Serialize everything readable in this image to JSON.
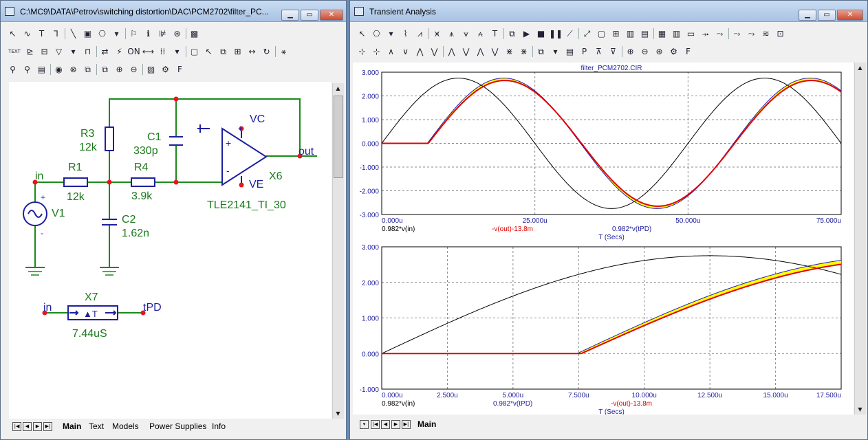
{
  "schematic": {
    "title": "C:\\MC9\\DATA\\Petrov\\switching distortion\\DAC\\PCM2702\\filter_PC...",
    "window_buttons": [
      "▁",
      "▭",
      "✕"
    ],
    "toolbar_row1": [
      "↖",
      "∿",
      "T",
      "⅂",
      "╲",
      "▣",
      "⎔",
      "▾",
      "⚐",
      "ℹ",
      "⊯",
      "⊛",
      "▩"
    ],
    "toolbar_row2": [
      "TEXT",
      "⊵",
      "⊟",
      "▽",
      "▾",
      "⊓",
      "⇄",
      "⚡",
      "ON",
      "⟷",
      "⁞⁞",
      "▾",
      "▢",
      "↖",
      "⧉",
      "⊞",
      "↔",
      "↻",
      "⚹"
    ],
    "toolbar_row3": [
      "⚲",
      "⚲",
      "▤",
      "◉",
      "⊗",
      "⧉",
      "⧉",
      "⊕",
      "⊖",
      "▨",
      "⚙",
      "F"
    ],
    "labels": {
      "in": "in",
      "r1": "R1",
      "r1_val": "12k",
      "r3": "R3",
      "r3_val": "12k",
      "c1": "C1",
      "c1_val": "330p",
      "r4": "R4",
      "r4_val": "3.9k",
      "c2": "C2",
      "c2_val": "1.62n",
      "v1": "V1",
      "vc": "VC",
      "ve": "VE",
      "out": "out",
      "x6": "X6",
      "model": "TLE2141_TI_30",
      "x7": "X7",
      "x7_in": "in",
      "x7_out": "tPD",
      "x7_val": "7.44uS",
      "x7_sym": "▲T",
      "plus": "+",
      "minus": "-"
    },
    "tabs": [
      "Main",
      "Text",
      "Models",
      "Power Supplies",
      "Info"
    ],
    "active_tab": "Main"
  },
  "transient": {
    "title": "Transient Analysis",
    "window_buttons": [
      "▁",
      "▭",
      "✕"
    ],
    "toolbar_row1": [
      "↖",
      "⎔",
      "▾",
      "⌇",
      "⩘",
      "⩙",
      "⩚",
      "⩛",
      "⩜",
      "T",
      "⧉",
      "▶",
      "■",
      "❚❚",
      "⟋",
      "⤢",
      "▢",
      "⊞",
      "▥",
      "▤",
      "▦",
      "▥",
      "▭",
      "⤞",
      "⤳",
      "⤳",
      "⤳",
      "≋",
      "⊡"
    ],
    "toolbar_row2": [
      "⊹",
      "⊹",
      "∧",
      "∨",
      "⋀",
      "⋁",
      "⋀",
      "⋁",
      "⋀",
      "⋁",
      "⋇",
      "⋇",
      "⧉",
      "▾",
      "▤",
      "P",
      "⊼",
      "⊽",
      "⊕",
      "⊖",
      "⊛",
      "⚙",
      "F"
    ],
    "plot1": {
      "title": "filter_PCM2702.CIR",
      "x_ticks": [
        "0.000u",
        "25.000u",
        "50.000u",
        "75.000u"
      ],
      "y_ticks": [
        "3.000",
        "2.000",
        "1.000",
        "0.000",
        "-1.000",
        "-2.000",
        "-3.000"
      ],
      "legend": [
        "0.982*v(in)",
        "-v(out)-13.8m",
        "0.982*v(tPD)"
      ],
      "xlabel": "T (Secs)"
    },
    "plot2": {
      "x_ticks": [
        "0.000u",
        "2.500u",
        "5.000u",
        "7.500u",
        "10.000u",
        "12.500u",
        "15.000u",
        "17.500u"
      ],
      "y_ticks": [
        "3.000",
        "2.000",
        "1.000",
        "0.000",
        "-1.000"
      ],
      "legend": [
        "0.982*v(in)",
        "0.982*v(tPD)",
        "-v(out)-13.8m"
      ],
      "xlabel": "T (Secs)"
    },
    "tabs": [
      "Main"
    ],
    "active_tab": "Main"
  },
  "colors": {
    "wire": "#1a8a1a",
    "node": "#e8141e",
    "component": "#1e1ea0",
    "label": "#1a7a1a",
    "trace_in": "#000000",
    "trace_out": "#e00000",
    "trace_tpd": "#2020c0",
    "fill": "#ffff00"
  },
  "chart_data": [
    {
      "type": "line",
      "title": "filter_PCM2702.CIR",
      "xlabel": "T (Secs)",
      "xlim": [
        0,
        75
      ],
      "ylim": [
        -3,
        3
      ],
      "x_unit": "u",
      "grid": true,
      "series": [
        {
          "name": "0.982*v(in)",
          "amplitude": 2.75,
          "period_us": 50,
          "delay_us": 0
        },
        {
          "name": "0.982*v(tPD)",
          "amplitude": 2.75,
          "period_us": 50,
          "delay_us": 7.44
        },
        {
          "name": "-v(out)-13.8m",
          "amplitude": 2.65,
          "period_us": 50,
          "delay_us": 7.6
        }
      ]
    },
    {
      "type": "line",
      "xlabel": "T (Secs)",
      "xlim": [
        0,
        17.5
      ],
      "ylim": [
        -1,
        3
      ],
      "x_unit": "u",
      "grid": true,
      "series": [
        {
          "name": "0.982*v(in)",
          "amplitude": 2.75,
          "period_us": 50,
          "delay_us": 0
        },
        {
          "name": "0.982*v(tPD)",
          "amplitude": 2.75,
          "period_us": 50,
          "delay_us": 7.44
        },
        {
          "name": "-v(out)-13.8m",
          "amplitude": 2.65,
          "period_us": 50,
          "delay_us": 7.6
        }
      ]
    }
  ]
}
